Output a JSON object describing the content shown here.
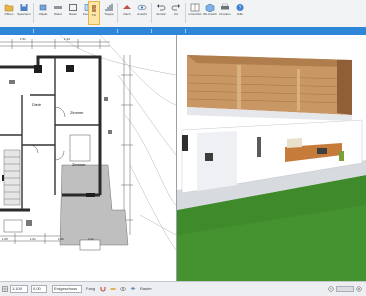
{
  "ribbon": {
    "buttons": [
      {
        "label": "Öffnen",
        "icon": "folder-icon"
      },
      {
        "label": "Speichern",
        "icon": "save-icon"
      },
      {
        "label": "Objekt",
        "icon": "object-icon"
      },
      {
        "label": "Wand",
        "icon": "wall-icon"
      },
      {
        "label": "Raum",
        "icon": "room-icon"
      },
      {
        "label": "Fenster",
        "icon": "window-icon"
      },
      {
        "label": "Tür",
        "icon": "door-icon"
      },
      {
        "label": "Treppe",
        "icon": "stairs-icon"
      },
      {
        "label": "Dach",
        "icon": "roof-icon"
      },
      {
        "label": "Ansicht",
        "icon": "view-icon"
      },
      {
        "label": "Zurück",
        "icon": "undo-icon"
      },
      {
        "label": "Vor",
        "icon": "redo-icon"
      },
      {
        "label": "Grundriss",
        "icon": "floorplan-icon"
      },
      {
        "label": "3D-Ansicht",
        "icon": "cube-icon"
      },
      {
        "label": "Drucken",
        "icon": "print-icon"
      },
      {
        "label": "Hilfe",
        "icon": "help-icon"
      }
    ]
  },
  "plan": {
    "rooms": [
      "Diele",
      "Zimmer",
      "Zimmer"
    ],
    "dimensions": [
      "1,05",
      "1,01",
      "1,00",
      "1,01",
      "1,51",
      "1,44"
    ]
  },
  "status": {
    "zoom_value": "1:100",
    "layer_value": "Erdgeschoss",
    "coord_value": "0,00",
    "snap_label": "Fang",
    "grid_label": "Raster"
  },
  "colors": {
    "accent": "#2e86d8",
    "grass": "#3f8a2b",
    "wood": "#c99763"
  }
}
